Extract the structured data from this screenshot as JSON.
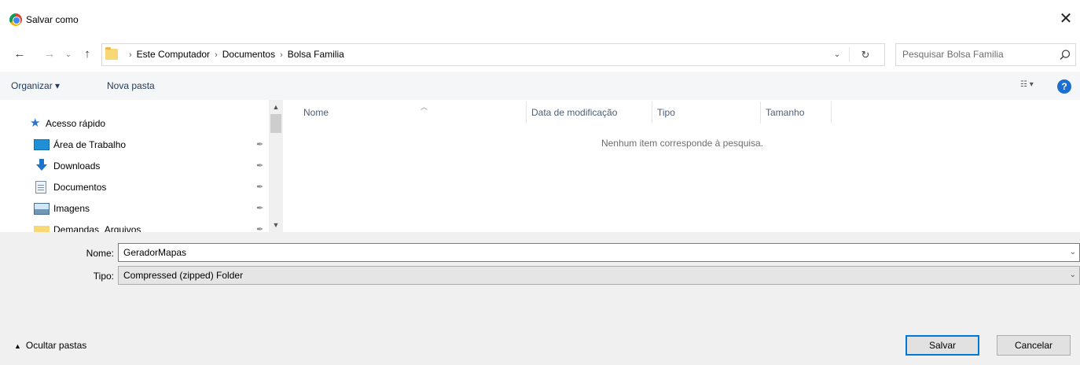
{
  "window": {
    "title": "Salvar como",
    "close_glyph": "✕",
    "app_icon": "chrome-icon"
  },
  "nav": {
    "back_glyph": "←",
    "forward_glyph": "→",
    "recent_glyph": "⌄",
    "up_glyph": "↑",
    "breadcrumbs": [
      "Este Computador",
      "Documentos",
      "Bolsa Familia"
    ],
    "separator": "›",
    "dropdown_glyph": "⌄",
    "refresh_glyph": "↻"
  },
  "search": {
    "placeholder": "Pesquisar Bolsa Familia"
  },
  "toolbar": {
    "organize_label": "Organizar ▾",
    "new_folder_label": "Nova pasta",
    "view_glyph": "☷ ▾",
    "help_glyph": "?"
  },
  "sidebar": {
    "quick_access": "Acesso rápido",
    "items": [
      {
        "label": "Área de Trabalho",
        "icon": "desktop-icon",
        "pinned": true
      },
      {
        "label": "Downloads",
        "icon": "downloads-icon",
        "pinned": true
      },
      {
        "label": "Documentos",
        "icon": "documents-icon",
        "pinned": true
      },
      {
        "label": "Imagens",
        "icon": "pictures-icon",
        "pinned": true
      },
      {
        "label": "Demandas_Arquivos",
        "icon": "folder-icon",
        "pinned": true
      }
    ],
    "pin_glyph": "📌"
  },
  "file_list": {
    "columns": [
      "Nome",
      "Data de modificação",
      "Tipo",
      "Tamanho"
    ],
    "empty_message": "Nenhum item corresponde à pesquisa."
  },
  "form": {
    "name_label": "Nome:",
    "name_value": "GeradorMapas",
    "type_label": "Tipo:",
    "type_value": "Compressed (zipped) Folder"
  },
  "footer": {
    "hide_folders_label": "Ocultar pastas",
    "save_label": "Salvar",
    "cancel_label": "Cancelar"
  },
  "colors": {
    "accent": "#0078d7",
    "toolbar_text": "#1e395b",
    "help_blue": "#1c6fd1",
    "folder_yellow": "#f8d775"
  }
}
